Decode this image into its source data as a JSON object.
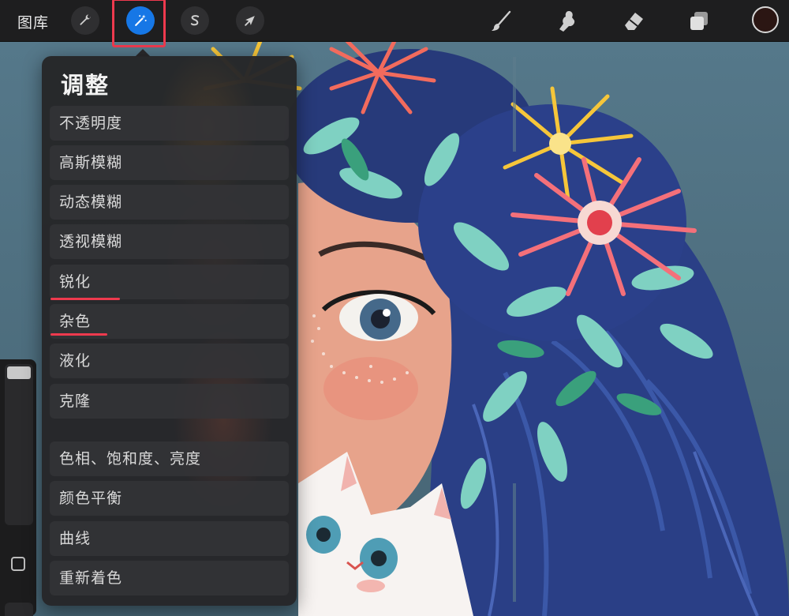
{
  "toolbar": {
    "gallery_label": "图库",
    "tools": [
      {
        "name": "actions",
        "icon": "wrench-icon"
      },
      {
        "name": "adjustments",
        "icon": "magic-wand-icon",
        "active": true
      },
      {
        "name": "selection",
        "icon": "selection-s-icon"
      },
      {
        "name": "transform",
        "icon": "arrow-cursor-icon"
      }
    ],
    "right_tools": [
      {
        "name": "brush",
        "icon": "brush-icon"
      },
      {
        "name": "smudge",
        "icon": "smudge-finger-icon"
      },
      {
        "name": "eraser",
        "icon": "eraser-icon"
      },
      {
        "name": "layers",
        "icon": "layers-icon"
      }
    ],
    "current_color": "#2b1613",
    "accent_color": "#1677e6"
  },
  "popover": {
    "title": "调整",
    "group1": [
      "不透明度",
      "高斯模糊",
      "动态模糊",
      "透视模糊",
      "锐化",
      "杂色",
      "液化",
      "克隆"
    ],
    "group2": [
      "色相、饱和度、亮度",
      "颜色平衡",
      "曲线",
      "重新着色"
    ]
  },
  "annotations": {
    "highlight_color": "#ee3a4e"
  }
}
